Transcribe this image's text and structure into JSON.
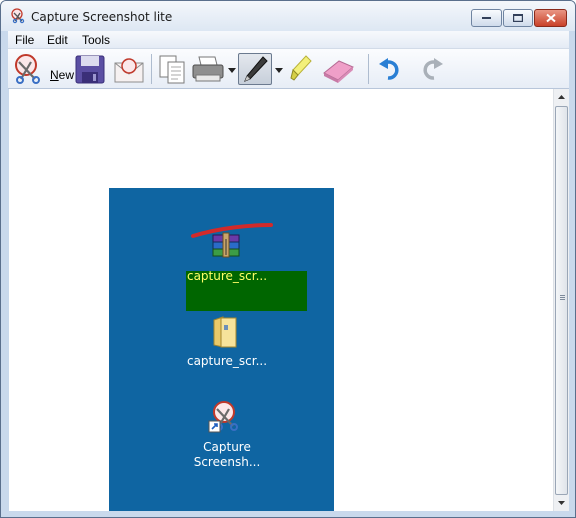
{
  "window": {
    "title": "Capture Screenshot lite",
    "app_icon": "capture-scissors-icon"
  },
  "menubar": {
    "items": [
      {
        "label": "File"
      },
      {
        "label": "Edit"
      },
      {
        "label": "Tools"
      }
    ]
  },
  "toolbar": {
    "new_label": "New",
    "buttons": [
      "new-capture-icon",
      "save-icon",
      "email-icon",
      "copy-icon",
      "print-icon",
      "pen-icon",
      "highlighter-icon",
      "eraser-icon",
      "undo-icon",
      "redo-icon"
    ]
  },
  "canvas": {
    "desktop_icons": [
      {
        "label": "capture_scr...",
        "icon": "winrar-archive-icon"
      },
      {
        "label": "capture_scr...",
        "icon": "folder-icon"
      },
      {
        "label": "Capture\nScreensh...",
        "line1": "Capture",
        "line2": "Screensh...",
        "icon": "capture-shortcut-icon"
      }
    ]
  },
  "colors": {
    "desktop_bg": "#0f65a2",
    "highlight_green": "#006600",
    "pen_red": "#d22a2a"
  }
}
